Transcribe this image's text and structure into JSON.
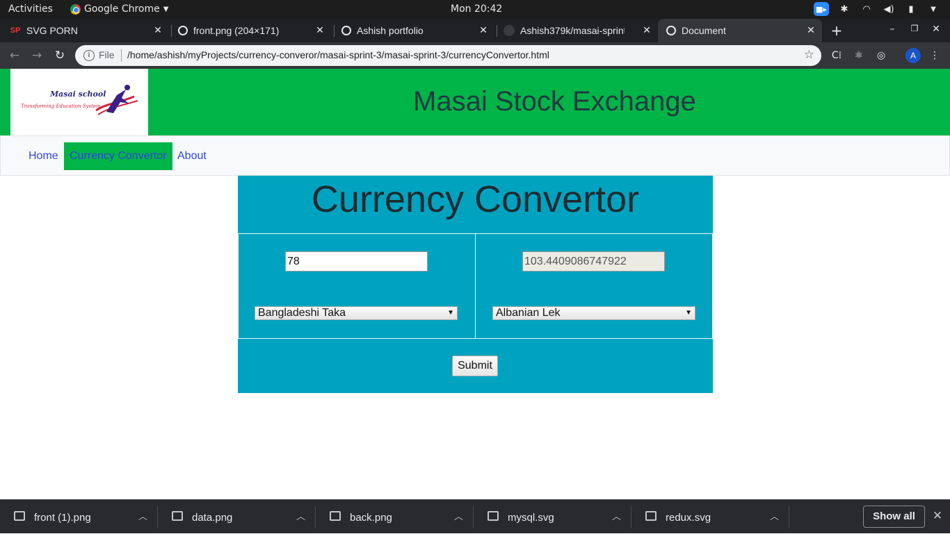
{
  "desktop": {
    "activities": "Activities",
    "app_name": "Google Chrome",
    "clock": "Mon 20:42"
  },
  "tabs": [
    {
      "title": "SVG PORN",
      "favicon": "sp-logo-icon"
    },
    {
      "title": "front.png (204×171)",
      "favicon": "globe-icon"
    },
    {
      "title": "Ashish portfolio",
      "favicon": "globe-icon"
    },
    {
      "title": "Ashish379k/masai-sprint",
      "favicon": "github-icon"
    },
    {
      "title": "Document",
      "favicon": "globe-icon",
      "active": true
    }
  ],
  "toolbar": {
    "scheme": "File",
    "url": "/home/ashish/myProjects/currency-converor/masai-sprint-3/masai-sprint-3/currencyConvertor.html",
    "profile_initial": "A"
  },
  "site": {
    "logo_line1": "Masai school",
    "logo_line2": "Transforming Education System",
    "title": "Masai Stock Exchange",
    "nav": [
      {
        "label": "Home",
        "active": false
      },
      {
        "label": "Currency Convertor",
        "active": true
      },
      {
        "label": "About",
        "active": false
      }
    ],
    "accent_green": "#00b447",
    "panel_teal": "#00a3bf"
  },
  "converter": {
    "title": "Currency Convertor",
    "from_amount": "78",
    "to_amount": "103.4409086747922",
    "from_currency": "Bangladeshi Taka",
    "to_currency": "Albanian Lek",
    "submit_label": "Submit"
  },
  "downloads": {
    "items": [
      "front (1).png",
      "data.png",
      "back.png",
      "mysql.svg",
      "redux.svg"
    ],
    "show_all": "Show all"
  }
}
